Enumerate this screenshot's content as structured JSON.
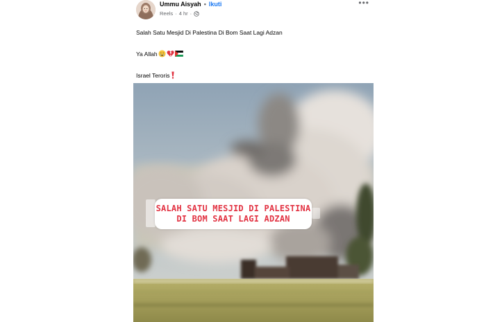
{
  "post": {
    "author": "Ummu Aisyah",
    "separator": "•",
    "follow_label": "Ikuti",
    "source": "Reels",
    "time": "4 hr",
    "meta_dot": "·",
    "more_label": "•••",
    "privacy_icon": "globe-icon",
    "caption": {
      "line1": "Salah Satu Mesjid Di Palestina Di Bom Saat Lagi Adzan",
      "line2": "Ya Allah",
      "line2_emojis": [
        "crying-face-emoji",
        "broken-heart-emoji",
        "palestine-flag-emoji"
      ],
      "line3": "Israel Teroris",
      "line3_emoji": "red-exclamation-emoji"
    }
  },
  "video": {
    "overlay_line1": "SALAH SATU MESJID DI PALESTINA",
    "overlay_line2": "DI BOM SAAT LAGI ADZAN",
    "overlay_text_color": "#e23242",
    "scene": "smoke-cloud-over-building"
  },
  "colors": {
    "link": "#1877f2",
    "meta": "#65676b",
    "text": "#050505"
  }
}
